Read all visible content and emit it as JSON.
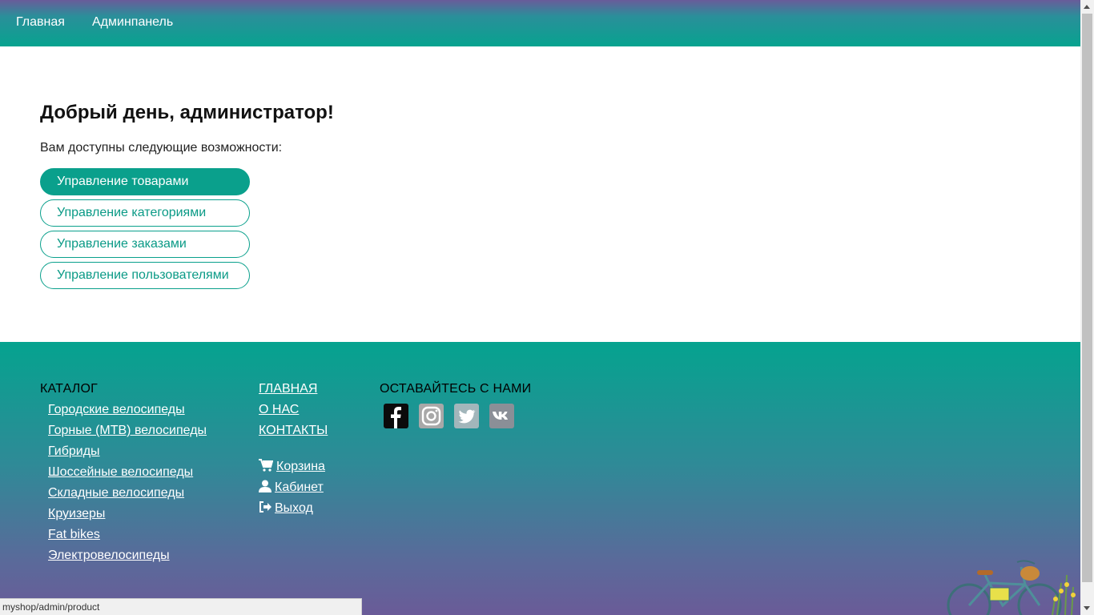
{
  "navbar": {
    "home": "Главная",
    "admin": "Админпанель"
  },
  "main": {
    "greeting": "Добрый день, администратор!",
    "subtitle": "Вам доступны следующие возможности:",
    "buttons": [
      "Управление товарами",
      "Управление категориями",
      "Управление заказами",
      "Управление пользователями"
    ]
  },
  "footer": {
    "catalog_title": "КАТАЛОГ",
    "catalog_items": [
      "Городские велосипеды",
      "Горные (MTB) велосипеды",
      "Гибриды",
      "Шоссейные велосипеды",
      "Складные велосипеды",
      "Круизеры",
      "Fat bikes",
      "Электровелосипеды"
    ],
    "main_links": [
      "ГЛАВНАЯ",
      "О НАС",
      "КОНТАКТЫ"
    ],
    "user_links": [
      {
        "icon": "cart-icon",
        "label": "Корзина"
      },
      {
        "icon": "user-icon",
        "label": "Кабинет"
      },
      {
        "icon": "sign-out-icon",
        "label": "Выход"
      }
    ],
    "social_title": "ОСТАВАЙТЕСЬ С НАМИ",
    "social": [
      "facebook-icon",
      "instagram-icon",
      "twitter-icon",
      "vk-icon"
    ]
  },
  "status_url": "myshop/admin/product",
  "colors": {
    "accent": "#0aa08c",
    "nav_top": "#695c9a",
    "footer_bottom": "#6a5b98"
  }
}
